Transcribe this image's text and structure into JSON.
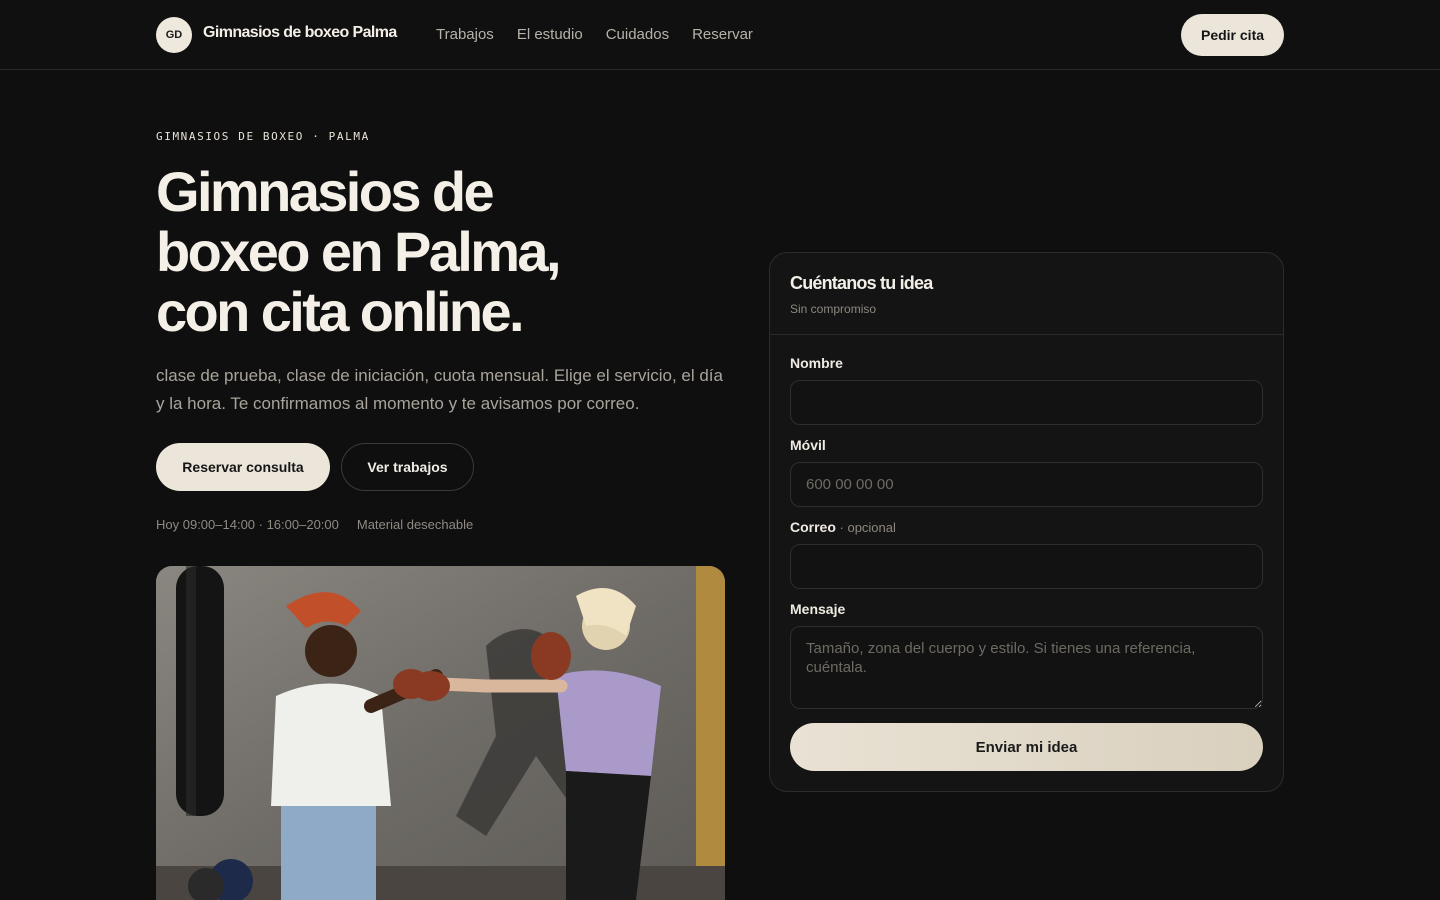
{
  "header": {
    "logo_initials": "GD",
    "brand": "Gimnasios de boxeo Palma",
    "nav": [
      "Trabajos",
      "El estudio",
      "Cuidados",
      "Reservar"
    ],
    "cta": "Pedir cita"
  },
  "hero": {
    "eyebrow": "GIMNASIOS DE BOXEO · PALMA",
    "title_lines": [
      "Gimnasios de",
      "boxeo en Palma,",
      "con cita online."
    ],
    "description": "clase de prueba, clase de iniciación, cuota mensual. Elige el servicio, el día y la hora. Te confirmamos al momento y te avisamos por correo.",
    "primary_button": "Reservar consulta",
    "secondary_button": "Ver trabajos",
    "meta": [
      "Hoy 09:00–14:00 · 16:00–20:00",
      "Material desechable"
    ]
  },
  "form": {
    "title": "Cuéntanos tu idea",
    "subtitle": "Sin compromiso",
    "name_label": "Nombre",
    "name_value": "",
    "phone_label": "Móvil",
    "phone_placeholder": "600 00 00 00",
    "email_label": "Correo",
    "email_optional": " · opcional",
    "email_value": "",
    "message_label": "Mensaje",
    "message_placeholder": "Tamaño, zona del cuerpo y estilo. Si tienes una referencia, cuéntala.",
    "submit": "Enviar mi idea"
  },
  "colors": {
    "background": "#0f0f0f",
    "accent": "#ece6da",
    "text": "#ece7dc",
    "muted": "#a9a49b"
  }
}
